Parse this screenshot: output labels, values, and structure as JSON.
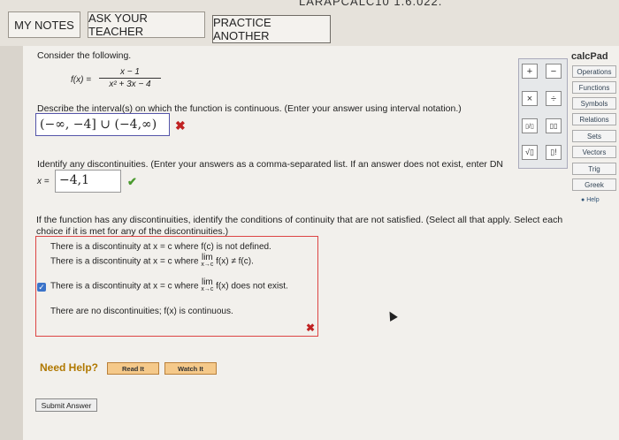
{
  "top": {
    "breadcrumb_fragment": "LARAPCALC10 1.6.022.",
    "buttons": [
      "MY NOTES",
      "ASK YOUR TEACHER",
      "PRACTICE ANOTHER"
    ]
  },
  "problem": {
    "intro": "Consider the following.",
    "function_lhs": "f(x) =",
    "numerator": "x − 1",
    "denominator": "x² + 3x − 4",
    "q1": "Describe the interval(s) on which the function is continuous. (Enter your answer using interval notation.)",
    "a1": "(−∞, −4] ∪ (−4,∞)",
    "q2": "Identify any discontinuities. (Enter your answers as a comma-separated list. If an answer does not exist, enter DN",
    "x_label": "x =",
    "a2": "−4,1",
    "q3": "If the function has any discontinuities, identify the conditions of continuity that are not satisfied. (Select all that apply. Select each choice if it is met for any of the discontinuities.)",
    "options": [
      {
        "text": "There is a discontinuity at x = c where f(c) is not defined.",
        "checked": false
      },
      {
        "pre": "There is a discontinuity at x = c where",
        "lim": "lim",
        "limsub": "x→c",
        "post": "f(x) ≠ f(c).",
        "checked": false
      },
      {
        "pre": "There is a discontinuity at x = c where",
        "lim": "lim",
        "limsub": "x→c",
        "post": "f(x) does not exist.",
        "checked": true
      },
      {
        "text": "There are no discontinuities; f(x) is continuous.",
        "checked": false
      }
    ]
  },
  "help": {
    "label": "Need Help?",
    "read": "Read It",
    "watch": "Watch It"
  },
  "submit": "Submit Answer",
  "calcpad": {
    "title": "calcPad",
    "tabs": [
      "Operations",
      "Functions",
      "Symbols",
      "Relations",
      "Sets",
      "Vectors",
      "Trig",
      "Greek"
    ],
    "help": "Help",
    "buttons": [
      "+",
      "−",
      "×",
      "÷",
      "▯/▯",
      "▯▯",
      "√▯",
      "▯!"
    ]
  }
}
